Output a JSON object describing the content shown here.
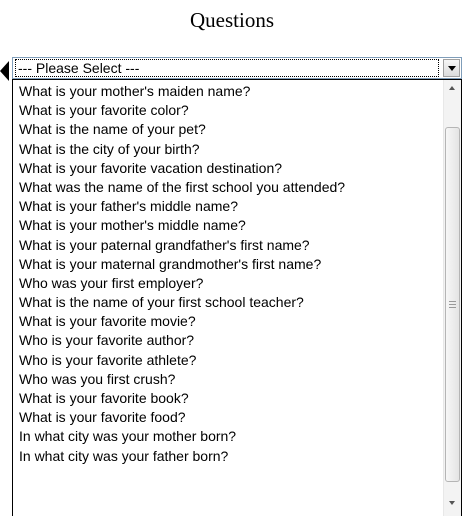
{
  "page": {
    "heading": "Questions"
  },
  "select": {
    "selected_value": "--- Please Select ---",
    "options": [
      "What is your mother's maiden name?",
      "What is your favorite color?",
      "What is the name of your pet?",
      "What is the city of your birth?",
      "What is your favorite vacation destination?",
      "What was the name of the first school you attended?",
      "What is your father's middle name?",
      "What is your mother's middle name?",
      "What is your paternal grandfather's first name?",
      "What is your maternal grandmother's first name?",
      "Who was your first employer?",
      "What is the name of your first school teacher?",
      "What is your favorite movie?",
      "Who is your favorite author?",
      "Who is your favorite athlete?",
      "Who was you first crush?",
      "What is your favorite book?",
      "What is your favorite food?",
      "In what city was your mother born?",
      "In what city was your father born?"
    ]
  },
  "icons": {
    "pointer": "pointer-arrow-icon",
    "dropdown_arrow": "chevron-down-icon",
    "scroll_up": "scroll-up-icon",
    "scroll_down": "scroll-down-icon"
  },
  "colors": {
    "select_border": "#7f9db9",
    "list_border": "#000000",
    "scrollbar_track": "#f3f3f3"
  }
}
